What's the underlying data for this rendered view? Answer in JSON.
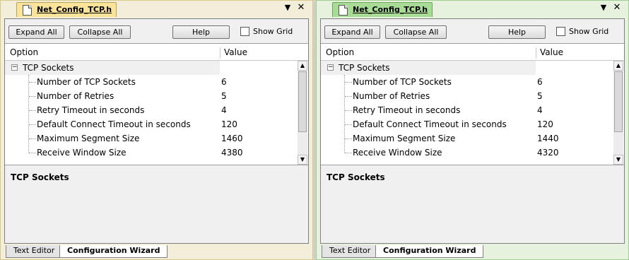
{
  "panels": [
    {
      "file_tab": "Net_Config_TCP.h",
      "toolbar": {
        "expand_all": "Expand All",
        "collapse_all": "Collapse All",
        "help": "Help",
        "show_grid": "Show Grid"
      },
      "grid": {
        "header": {
          "option": "Option",
          "value": "Value"
        },
        "group": {
          "expander": "−",
          "label": "TCP Sockets"
        },
        "items": [
          {
            "label": "Number of TCP Sockets",
            "value": "6"
          },
          {
            "label": "Number of Retries",
            "value": "5"
          },
          {
            "label": "Retry Timeout in seconds",
            "value": "4"
          },
          {
            "label": "Default Connect Timeout in seconds",
            "value": "120"
          },
          {
            "label": "Maximum Segment Size",
            "value": "1460"
          },
          {
            "label": "Receive Window Size",
            "value": "4380"
          }
        ]
      },
      "description": {
        "title": "TCP Sockets"
      },
      "bottom_tabs": {
        "text_editor": "Text Editor",
        "config_wizard": "Configuration Wizard"
      }
    },
    {
      "file_tab": "Net_Config_TCP.h",
      "toolbar": {
        "expand_all": "Expand All",
        "collapse_all": "Collapse All",
        "help": "Help",
        "show_grid": "Show Grid"
      },
      "grid": {
        "header": {
          "option": "Option",
          "value": "Value"
        },
        "group": {
          "expander": "−",
          "label": "TCP Sockets"
        },
        "items": [
          {
            "label": "Number of TCP Sockets",
            "value": "6"
          },
          {
            "label": "Number of Retries",
            "value": "5"
          },
          {
            "label": "Retry Timeout in seconds",
            "value": "4"
          },
          {
            "label": "Default Connect Timeout in seconds",
            "value": "120"
          },
          {
            "label": "Maximum Segment Size",
            "value": "1440"
          },
          {
            "label": "Receive Window Size",
            "value": "4320"
          }
        ]
      },
      "description": {
        "title": "TCP Sockets"
      },
      "bottom_tabs": {
        "text_editor": "Text Editor",
        "config_wizard": "Configuration Wizard"
      }
    }
  ],
  "icons": {
    "dropdown": "▼",
    "close": "✕",
    "scroll_up": "▲",
    "scroll_down": "▼"
  },
  "colors": {
    "left_tab_accent": "#fbe49a",
    "right_tab_accent": "#a8dc96"
  }
}
